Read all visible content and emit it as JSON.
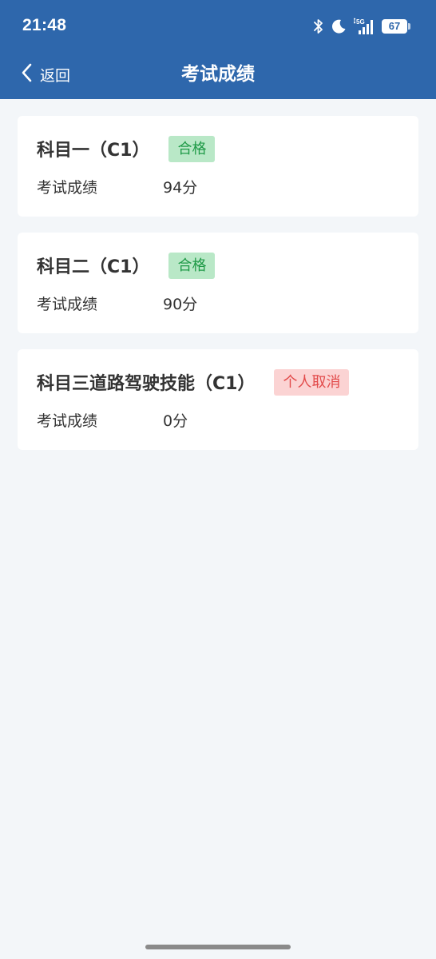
{
  "status_bar": {
    "time": "21:48",
    "battery": "67",
    "icons": [
      "bluetooth-icon",
      "moon-icon",
      "signal-5g-icon",
      "battery-icon"
    ]
  },
  "nav": {
    "back_label": "返回",
    "title": "考试成绩"
  },
  "results": [
    {
      "subject": "科目一（C1）",
      "status": "合格",
      "status_type": "pass",
      "score_label": "考试成绩",
      "score": "94分"
    },
    {
      "subject": "科目二（C1）",
      "status": "合格",
      "status_type": "pass",
      "score_label": "考试成绩",
      "score": "90分"
    },
    {
      "subject": "科目三道路驾驶技能（C1）",
      "status": "个人取消",
      "status_type": "cancel",
      "score_label": "考试成绩",
      "score": "0分"
    }
  ],
  "colors": {
    "header_bg": "#2e67ac",
    "page_bg": "#f3f6f9",
    "pass_bg": "#b9e8c7",
    "pass_text": "#1f9a47",
    "cancel_bg": "#fbd3d3",
    "cancel_text": "#e24a4a"
  }
}
